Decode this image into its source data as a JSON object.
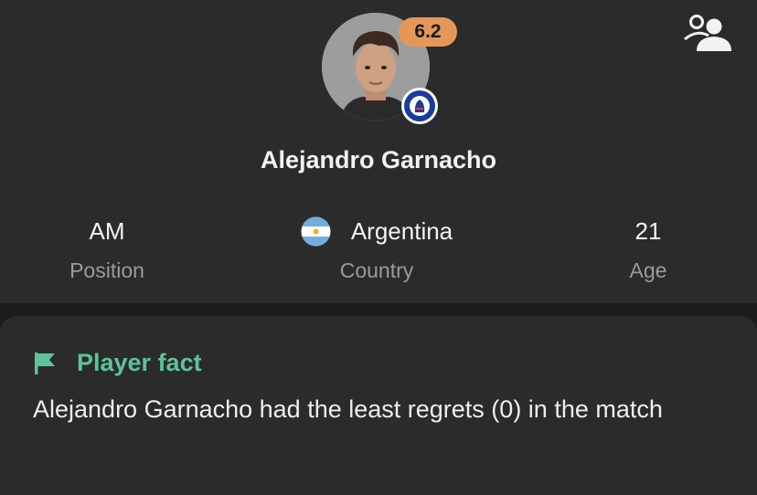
{
  "player": {
    "name": "Alejandro Garnacho",
    "rating": "6.2"
  },
  "colors": {
    "rating_badge": "#e5975a",
    "fact_accent": "#5cc39a",
    "card_background": "#2b2b2b"
  },
  "icons": {
    "compare": "people-compare-icon",
    "flag": "flag-icon",
    "country_flag": "argentina-flag-icon",
    "club": "chelsea-crest-icon"
  },
  "stats": {
    "position": {
      "value": "AM",
      "label": "Position"
    },
    "country": {
      "value": "Argentina",
      "label": "Country"
    },
    "age": {
      "value": "21",
      "label": "Age"
    }
  },
  "fact": {
    "title": "Player fact",
    "text": "Alejandro Garnacho had the least regrets (0) in the match"
  }
}
